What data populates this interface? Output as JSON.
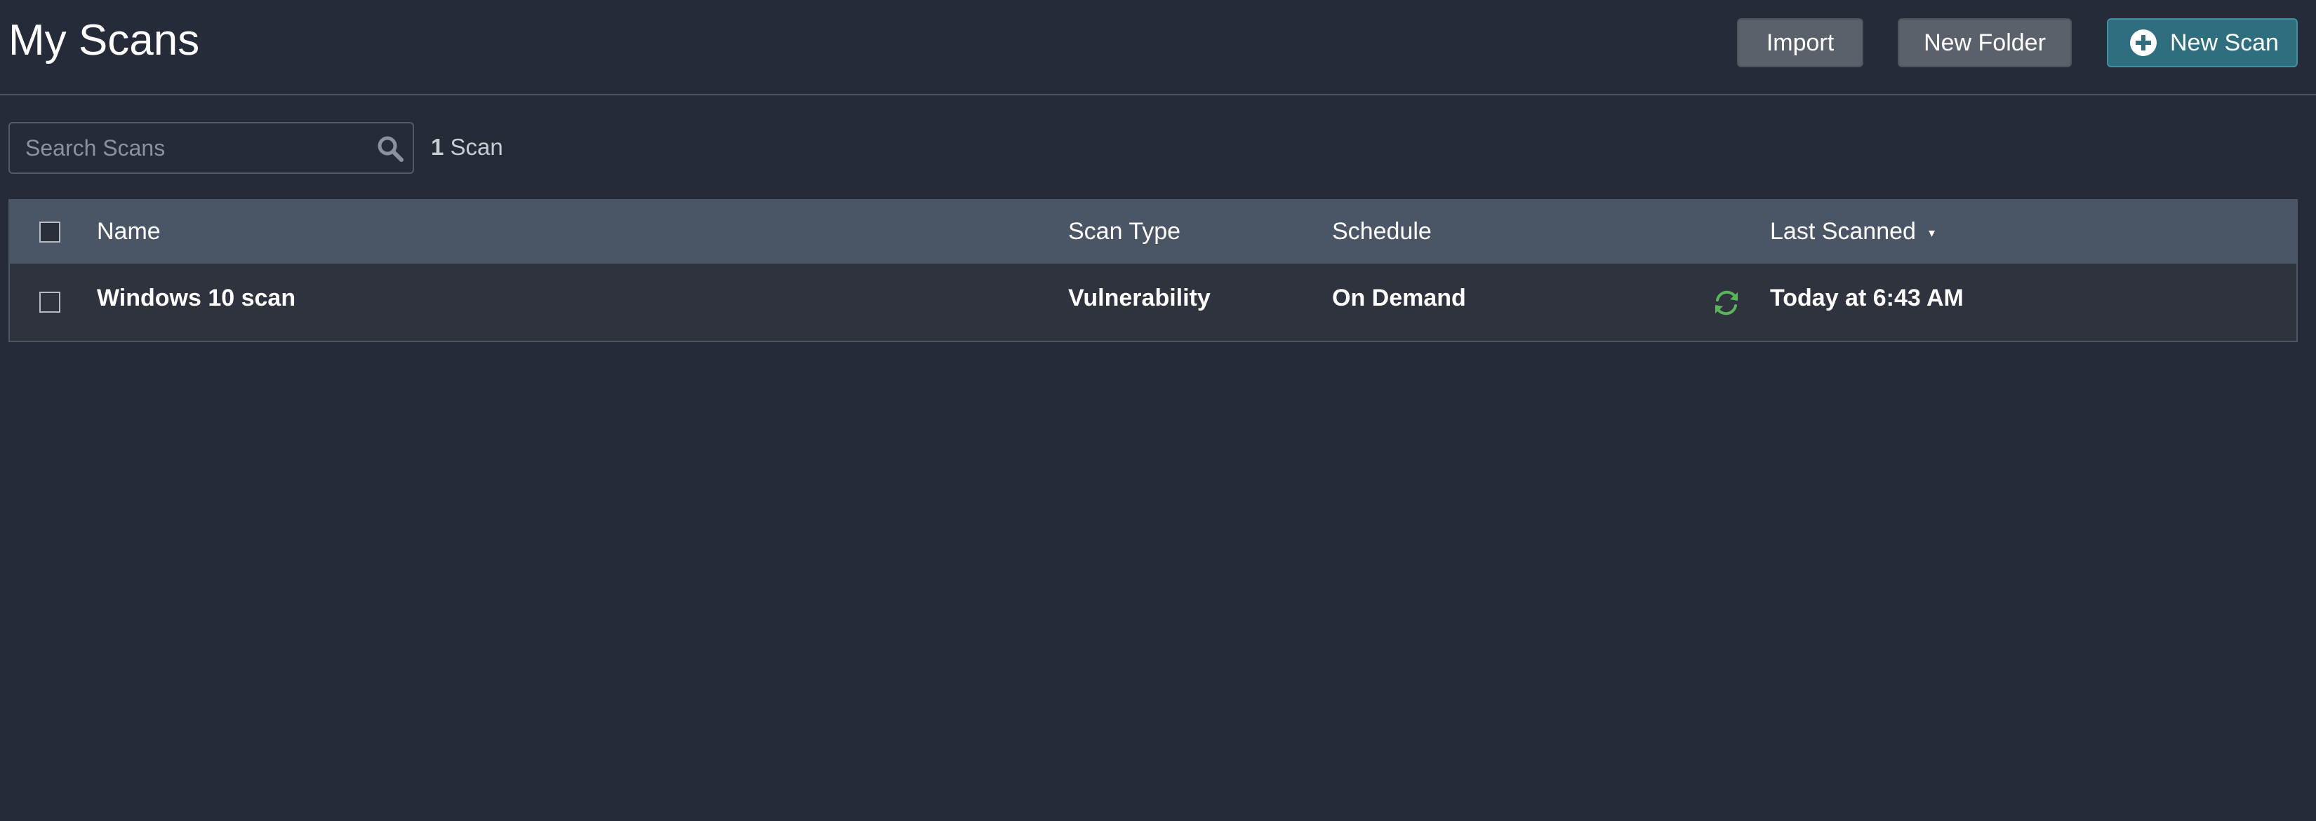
{
  "header": {
    "title": "My Scans",
    "buttons": {
      "import_label": "Import",
      "new_folder_label": "New Folder",
      "new_scan_label": "New Scan"
    }
  },
  "search": {
    "placeholder": "Search Scans",
    "value": "",
    "count_number": "1",
    "count_label": "Scan"
  },
  "table": {
    "columns": {
      "name": "Name",
      "scan_type": "Scan Type",
      "schedule": "Schedule",
      "last_scanned": "Last Scanned"
    },
    "sort_indicator": "▾",
    "rows": [
      {
        "name": "Windows 10 scan",
        "scan_type": "Vulnerability",
        "schedule": "On Demand",
        "status_icon": "sync-icon",
        "last_scanned": "Today at 6:43 AM"
      }
    ]
  },
  "colors": {
    "background": "#252b38",
    "table_header": "#4a5565",
    "row_background": "#2e333e",
    "primary_button": "#2e6e7e",
    "secondary_button": "#5b616b",
    "status_green": "#5ab55a"
  }
}
